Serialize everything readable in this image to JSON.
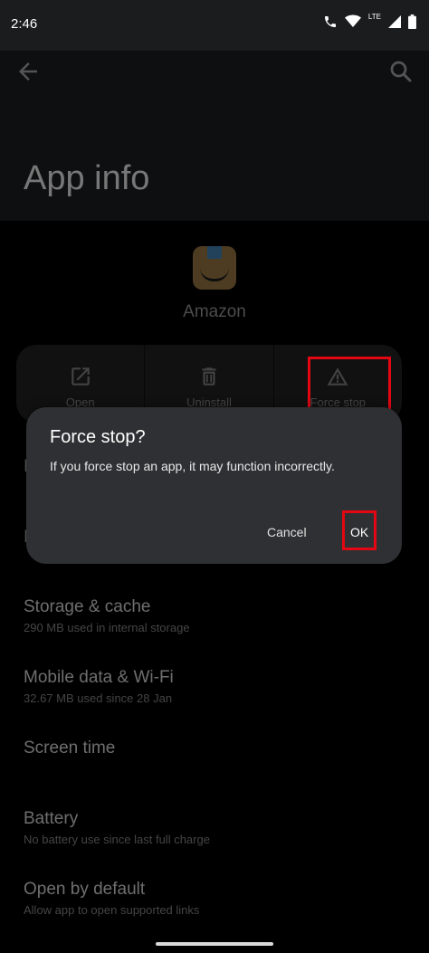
{
  "status_bar": {
    "time": "2:46",
    "lte": "LTE"
  },
  "header": {
    "title": "App info"
  },
  "app": {
    "name": "Amazon"
  },
  "actions": [
    {
      "label": "Open"
    },
    {
      "label": "Uninstall"
    },
    {
      "label": "Force stop"
    }
  ],
  "dialog": {
    "title": "Force stop?",
    "message": "If you force stop an app, it may function incorrectly.",
    "cancel": "Cancel",
    "ok": "OK"
  },
  "settings": [
    {
      "title": "Storage & cache",
      "subtitle": "290 MB used in internal storage"
    },
    {
      "title": "Mobile data & Wi-Fi",
      "subtitle": "32.67 MB used since 28 Jan"
    },
    {
      "title": "Screen time",
      "subtitle": ""
    },
    {
      "title": "Battery",
      "subtitle": "No battery use since last full charge"
    },
    {
      "title": "Open by default",
      "subtitle": "Allow app to open supported links"
    }
  ],
  "colors": {
    "highlight": "#e30613",
    "dialog_bg": "#2f3033",
    "header_bg": "#1b1c1e"
  },
  "icons": [
    "back-arrow-icon",
    "search-icon",
    "open-external-icon",
    "trash-icon",
    "warning-icon",
    "wifi-icon",
    "signal-icon",
    "battery-icon",
    "call-icon"
  ]
}
